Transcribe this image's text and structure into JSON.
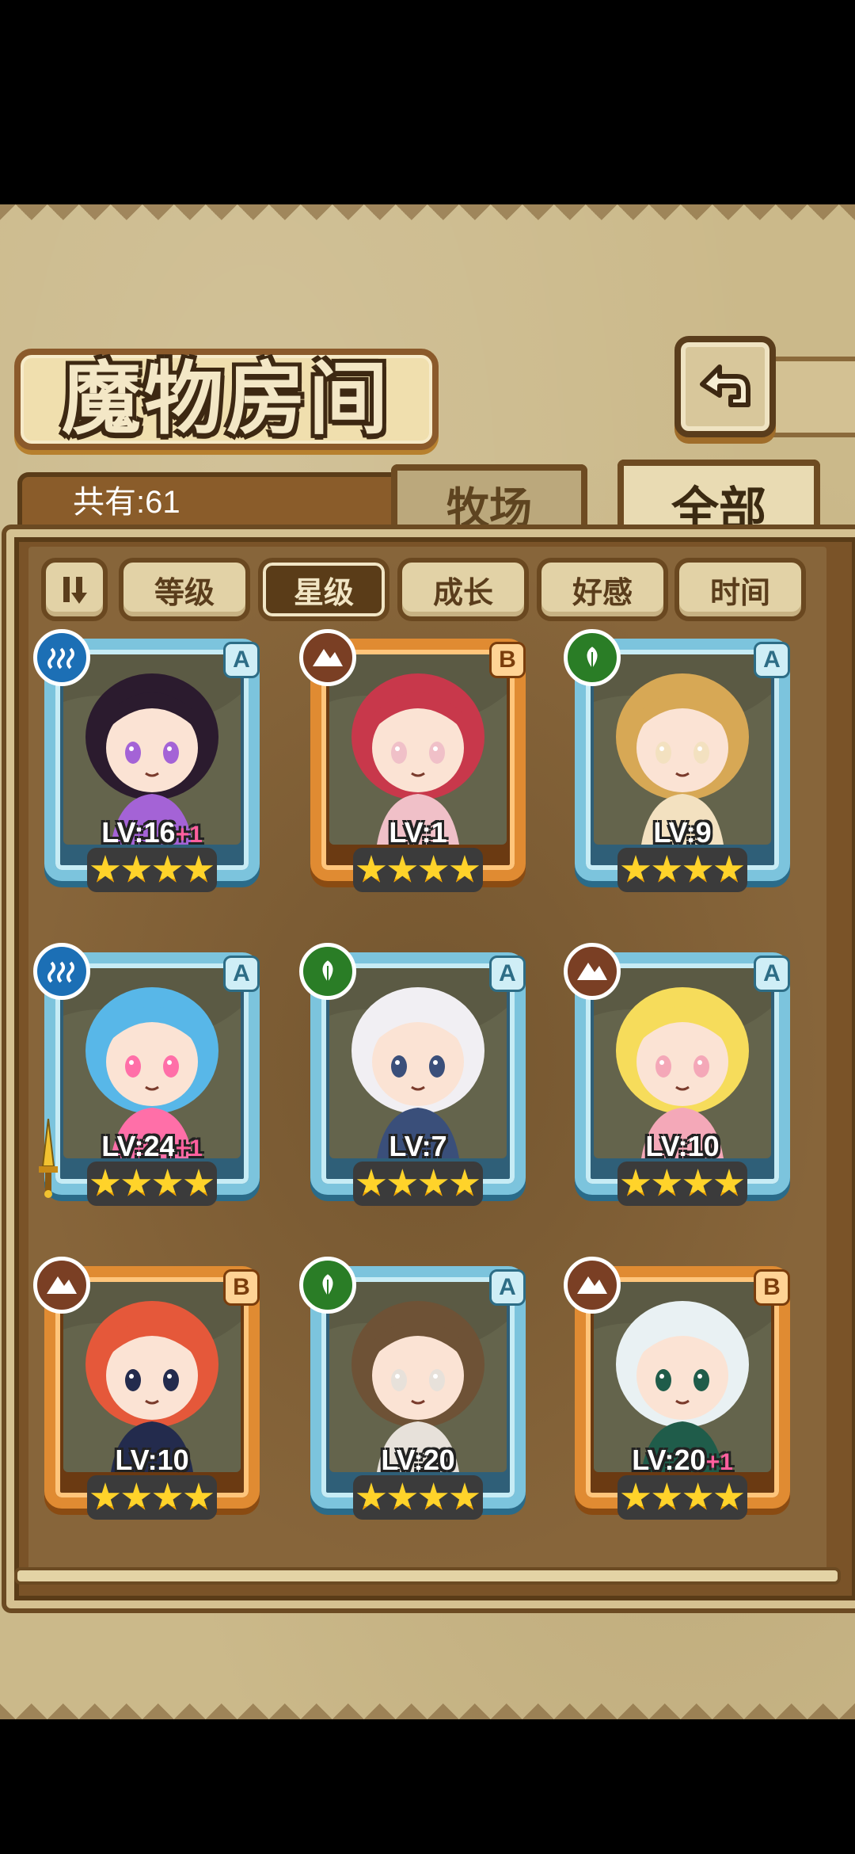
{
  "page": {
    "title": "魔物房间",
    "back_icon": "back-arrow-icon"
  },
  "count": {
    "label": "共有:61"
  },
  "tabs": [
    {
      "label": "牧场",
      "active": false
    },
    {
      "label": "全部",
      "active": true
    }
  ],
  "sort": {
    "toggle_icon": "sort-order-icon",
    "options": [
      {
        "label": "等级",
        "active": false
      },
      {
        "label": "星级",
        "active": true
      },
      {
        "label": "成长",
        "active": false
      },
      {
        "label": "好感",
        "active": false
      },
      {
        "label": "时间",
        "active": false
      }
    ]
  },
  "monsters": [
    {
      "level": "LV:16",
      "bonus": "+1",
      "rank": "A",
      "element": "water",
      "stars": 4,
      "colors": [
        "#2b1b2e",
        "#a463d6"
      ]
    },
    {
      "level": "LV:1",
      "bonus": "",
      "rank": "B",
      "element": "earth",
      "stars": 4,
      "colors": [
        "#c8384b",
        "#f0c0c8"
      ]
    },
    {
      "level": "LV:9",
      "bonus": "",
      "rank": "A",
      "element": "wood",
      "stars": 4,
      "colors": [
        "#d7a855",
        "#f3e1c0"
      ]
    },
    {
      "level": "LV:24",
      "bonus": "+1",
      "rank": "A",
      "element": "water",
      "stars": 4,
      "colors": [
        "#58b7e8",
        "#ff6fa8"
      ],
      "equipped": true
    },
    {
      "level": "LV:7",
      "bonus": "",
      "rank": "A",
      "element": "wood",
      "stars": 4,
      "colors": [
        "#f1eff3",
        "#3a4f7a"
      ]
    },
    {
      "level": "LV:10",
      "bonus": "",
      "rank": "A",
      "element": "earth",
      "stars": 4,
      "colors": [
        "#f6dc5b",
        "#f4a8b8"
      ]
    },
    {
      "level": "LV:10",
      "bonus": "",
      "rank": "B",
      "element": "earth",
      "stars": 4,
      "colors": [
        "#e5583a",
        "#232b4d"
      ]
    },
    {
      "level": "LV:20",
      "bonus": "",
      "rank": "A",
      "element": "wood",
      "stars": 4,
      "colors": [
        "#6e5236",
        "#e7e1da"
      ]
    },
    {
      "level": "LV:20",
      "bonus": "+1",
      "rank": "B",
      "element": "earth",
      "stars": 4,
      "colors": [
        "#e9f1f3",
        "#1f5c4a"
      ]
    }
  ]
}
